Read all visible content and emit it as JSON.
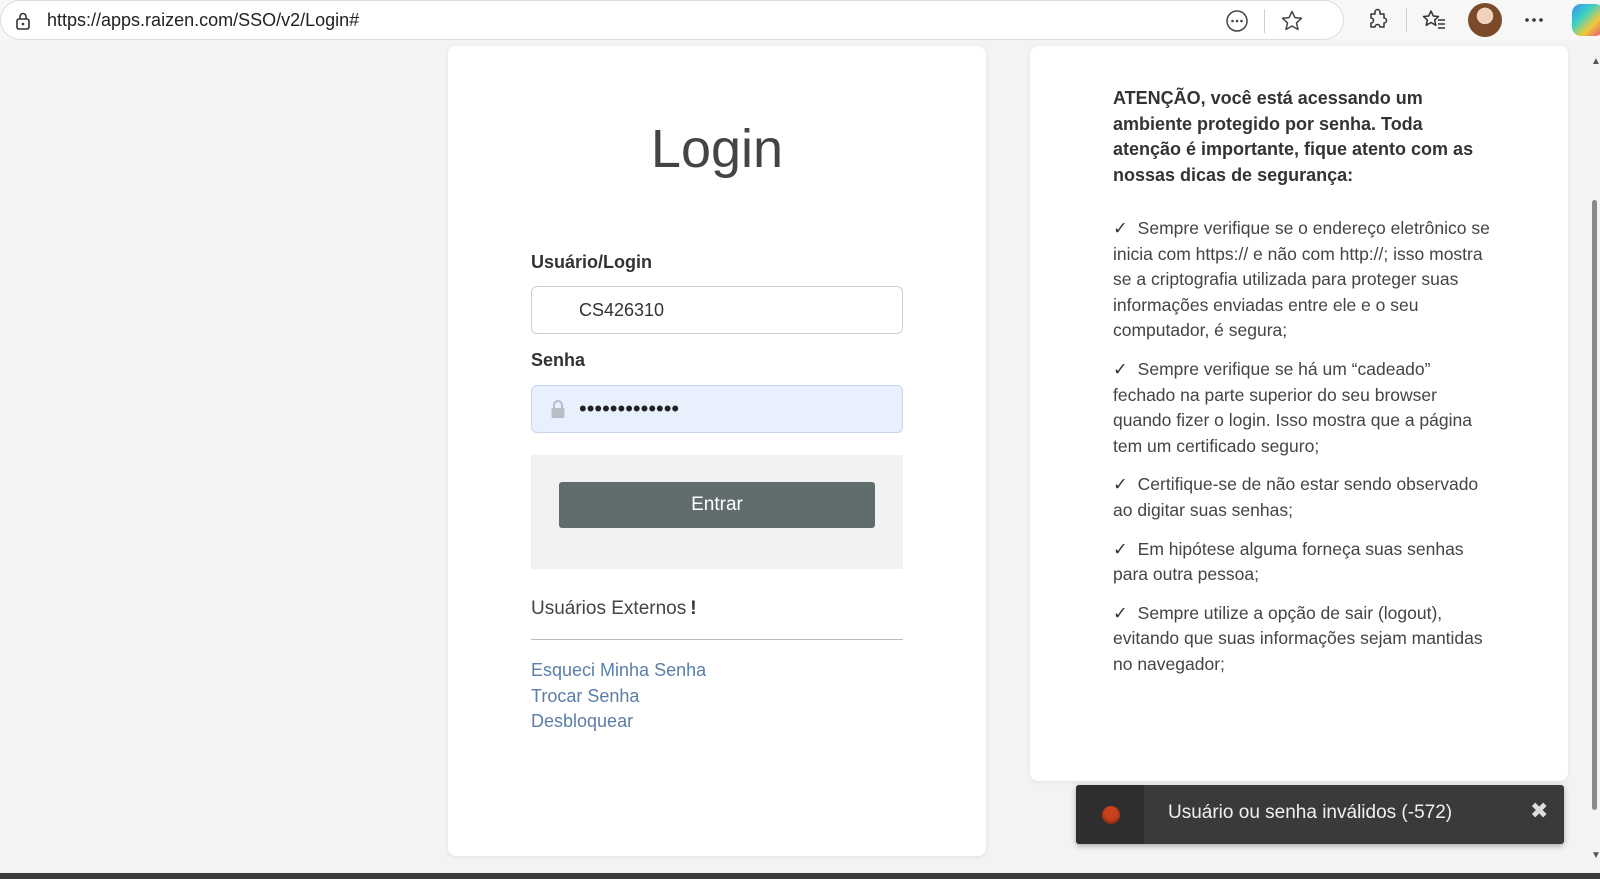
{
  "browser": {
    "url": "https://apps.raizen.com/SSO/v2/Login#"
  },
  "login": {
    "title": "Login",
    "username_label": "Usuário/Login",
    "username_value": "CS426310",
    "password_label": "Senha",
    "password_masked": "•••••••••••••",
    "submit_label": "Entrar",
    "external_users_label": "Usuários Externos",
    "external_users_mark": "!",
    "links": [
      "Esqueci Minha Senha",
      "Trocar Senha",
      "Desbloquear"
    ]
  },
  "security_info": {
    "heading": "ATENÇÃO, você está acessando um ambiente protegido por senha. Toda atenção é importante, fique atento com as nossas dicas de segurança:",
    "check_mark": "✓",
    "tips": [
      "Sempre verifique se o endereço eletrônico se inicia com https:// e não com http://; isso mostra se a criptografia utilizada para proteger suas informações enviadas entre ele e o seu computador, é segura;",
      "Sempre verifique se há um “cadeado” fechado na parte superior do seu browser quando fizer o login. Isso mostra que a página tem um certificado seguro;",
      "Certifique-se de não estar sendo observado ao digitar suas senhas;",
      "Em hipótese alguma forneça suas senhas para outra pessoa;",
      "Sempre utilize a opção de sair (logout), evitando que suas informações sejam mantidas no navegador;"
    ]
  },
  "toast": {
    "message": "Usuário ou senha inválidos (-572)",
    "close_glyph": "✖",
    "status_color": "#c8401e"
  },
  "icons": {
    "site_info": "lock-icon",
    "reader": "reading-view-icon",
    "favorite": "star-icon",
    "extensions": "puzzle-icon",
    "favorites_list": "favorites-icon",
    "profile": "avatar",
    "more": "more-icon",
    "copilot": "copilot-icon"
  }
}
